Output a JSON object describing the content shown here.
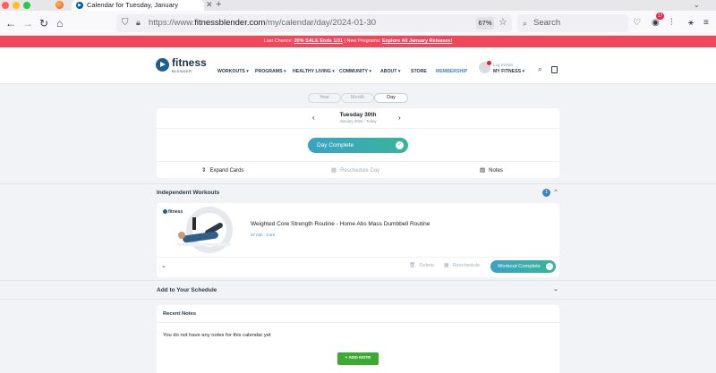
{
  "browser": {
    "tab_title": "Calendar for Tuesday, January",
    "url_prefix": "https://www.",
    "url_domain": "fitnessblender.com",
    "url_path": "/my/calendar/day/2024-01-30",
    "zoom": "67%",
    "search_placeholder": "Search",
    "extension_badge": "17"
  },
  "promo": {
    "lead": "Last Chance: ",
    "sale_link": "20% SALE Ends 1/31",
    "middle": " | New Programs: ",
    "programs_link": "Explore All January Releases!"
  },
  "header": {
    "logo_word": "fitness",
    "logo_sub": "BLENDER",
    "menu": [
      "WORKOUTS ▾",
      "PROGRAMS ▾",
      "HEALTHY LIVING ▾",
      "COMMUNITY ▾",
      "ABOUT ▾",
      "STORE",
      "MEMBERSHIP"
    ],
    "login_hint": "Log In/Join",
    "my_fitness": "MY FITNESS ▾"
  },
  "view_tabs": [
    "Year",
    "Month",
    "Day"
  ],
  "active_view": "Day",
  "calendar": {
    "date_title": "Tuesday 30th",
    "date_sub": "January 2024 - Today",
    "day_complete_label": "Day Complete",
    "actions": {
      "expand": "Expand Cards",
      "reschedule": "Reschedule Day",
      "notes": "Notes"
    }
  },
  "independent": {
    "title": "Independent Workouts",
    "count": "1",
    "workout": {
      "title": "Weighted Core Strength Routine - Home Abs Mass Dumbbell Routine",
      "meta": "37 min · Core",
      "thumb_logo": "fitness",
      "delete": "Delete",
      "reschedule": "Reschedule",
      "complete": "Workout Complete"
    }
  },
  "schedule": {
    "title": "Add to Your Schedule"
  },
  "notes": {
    "title": "Recent Notes",
    "empty": "You do not have any notes for this calendar yet",
    "add_button": "+ ADD NOTE"
  },
  "colors": {
    "promo_red": "#f0475a",
    "teal_gradient_start": "#3aa2c4",
    "teal_gradient_end": "#38b59a",
    "green_button": "#3aaa35",
    "link_blue": "#3e86c1"
  }
}
